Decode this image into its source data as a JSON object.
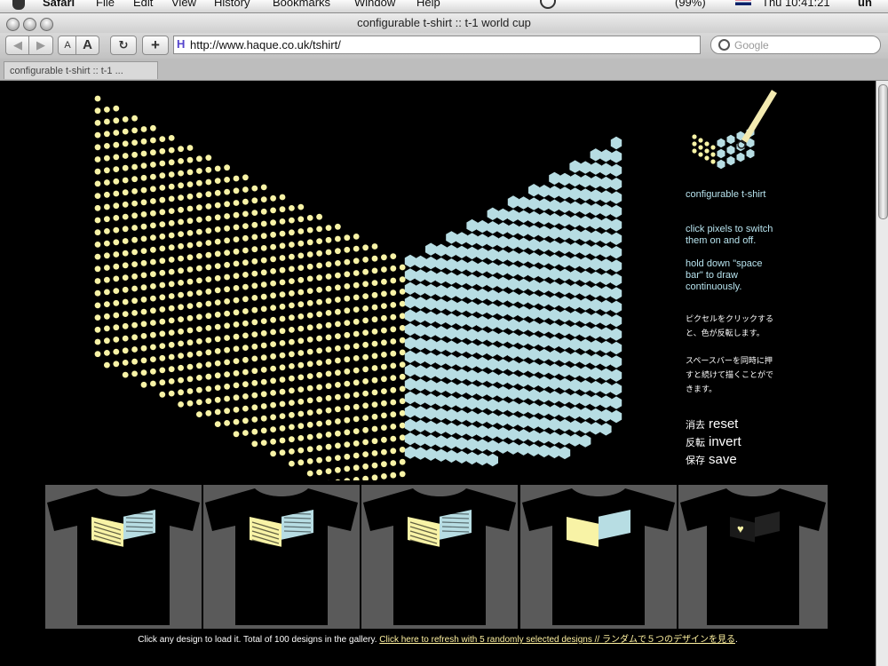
{
  "menubar": {
    "app": "Safari",
    "items": [
      "File",
      "Edit",
      "View",
      "History",
      "Bookmarks",
      "Window",
      "Help"
    ],
    "battery": "(99%)",
    "clock": "Thu 10:41:21",
    "user": "un"
  },
  "window": {
    "title": "configurable t-shirt :: t-1 world cup"
  },
  "toolbar": {
    "back_label": "◀",
    "forward_label": "▶",
    "text_small": "A",
    "text_large": "A",
    "reload_label": "↻",
    "add_label": "+",
    "url": "http://www.haque.co.uk/tshirt/",
    "search_placeholder": "Google"
  },
  "tabs": [
    {
      "label": "configurable t-shirt :: t-1 ..."
    }
  ],
  "colors": {
    "left_panel": "#f8f3a6",
    "right_panel": "#b7dde3",
    "background": "#000000",
    "gallery_bg": "#5a5a5a"
  },
  "sidebar": {
    "title": "configurable t-shirt",
    "help1": "click pixels to switch them on and off.",
    "help2": "hold down \"space bar\" to draw continuously.",
    "jp_help1": "ピクセルをクリックすると、色が反転します。",
    "jp_help2": "スペースバーを同時に押すと続けて描くことができます。",
    "actions": [
      {
        "jp": "消去",
        "label": "reset"
      },
      {
        "jp": "反転",
        "label": "invert"
      },
      {
        "jp": "保存",
        "label": "save"
      }
    ]
  },
  "gallery": {
    "designs": [
      "design-1",
      "design-2",
      "design-3",
      "design-4",
      "design-5"
    ],
    "caption": "Click any design to load it. Total of 100 designs in the gallery.",
    "refresh_link": "Click here to refresh with 5 randomly selected designs // ランダムで５つのデザインを見る",
    "trailing": "."
  }
}
